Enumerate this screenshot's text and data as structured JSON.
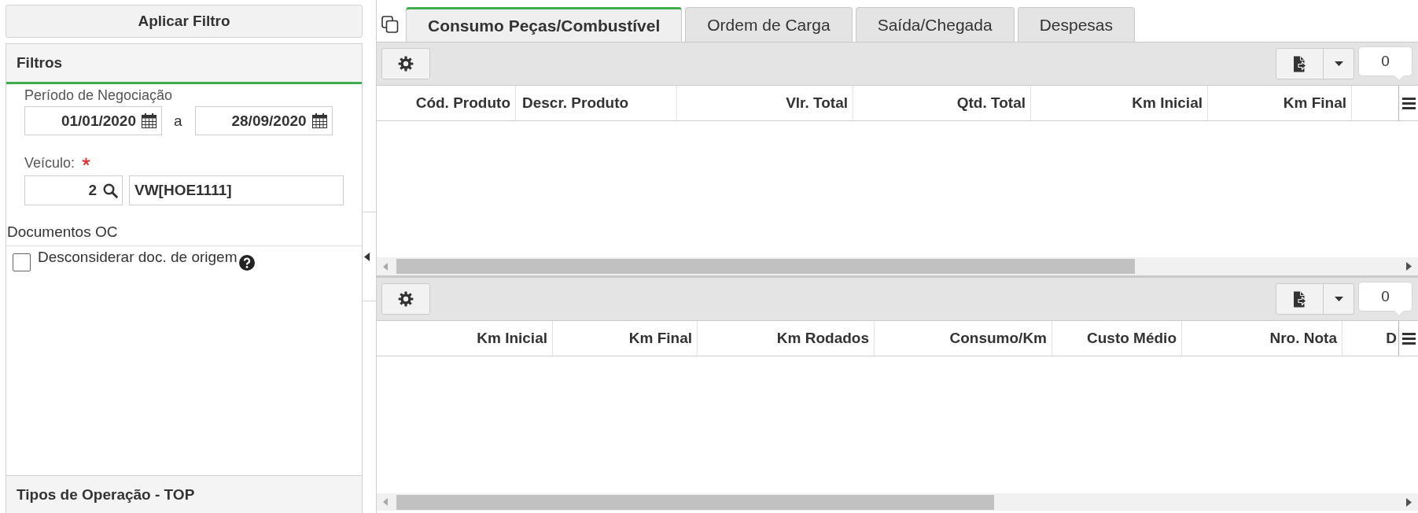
{
  "filter_panel": {
    "apply_button": "Aplicar Filtro",
    "title": "Filtros",
    "period": {
      "label": "Período de Negociação",
      "from": "01/01/2020",
      "separator": "a",
      "to": "28/09/2020"
    },
    "vehicle": {
      "label": "Veículo:",
      "required": true,
      "code": "2",
      "name": "VW[HOE1111]"
    },
    "documents": {
      "title": "Documentos OC",
      "options": [
        {
          "label": "Desconsiderar doc. de origem",
          "checked": false
        }
      ]
    },
    "next_section": "Tipos de Operação - TOP"
  },
  "tabs": [
    {
      "label": "Consumo Peças/Combustível",
      "selected": true
    },
    {
      "label": "Ordem de Carga",
      "selected": false
    },
    {
      "label": "Saída/Chegada",
      "selected": false
    },
    {
      "label": "Despesas",
      "selected": false
    }
  ],
  "grids": [
    {
      "record_count": "0",
      "columns": [
        {
          "label": "Cód. Produto",
          "kind": "number"
        },
        {
          "label": "Descr. Produto",
          "kind": "text"
        },
        {
          "label": "Vlr. Total",
          "kind": "number"
        },
        {
          "label": "Qtd. Total",
          "kind": "number"
        },
        {
          "label": "Km Inicial",
          "kind": "number"
        },
        {
          "label": "Km Final",
          "kind": "number"
        }
      ]
    },
    {
      "record_count": "0",
      "columns": [
        {
          "label": "Km Inicial",
          "kind": "number"
        },
        {
          "label": "Km Final",
          "kind": "number"
        },
        {
          "label": "Km Rodados",
          "kind": "number"
        },
        {
          "label": "Consumo/Km",
          "kind": "number"
        },
        {
          "label": "Custo Médio",
          "kind": "number"
        },
        {
          "label": "Nro. Nota",
          "kind": "number"
        },
        {
          "label": "D",
          "kind": "number"
        }
      ]
    }
  ]
}
